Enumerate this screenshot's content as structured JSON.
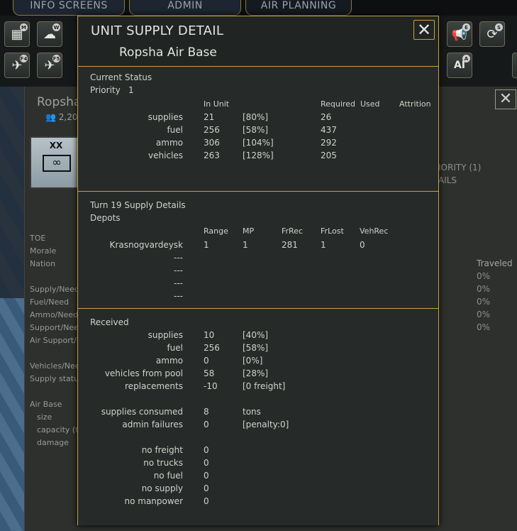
{
  "top_tabs": [
    "INFO SCREENS",
    "ADMIN",
    "AIR PLANNING"
  ],
  "toolbar_tags": [
    "M",
    "W",
    "F4",
    "F5",
    "E",
    "S",
    "A"
  ],
  "toolbar_text": [
    "AI"
  ],
  "unit_panel": {
    "name_partial": "Ropsha",
    "strength_partial": "2,20",
    "counter_label": "XX",
    "right_lines": [
      "IORITY (1)",
      "AILS"
    ],
    "labels": [
      "TOE",
      "Morale",
      "Nation",
      "",
      "Supply/Need",
      "Fuel/Need",
      "Ammo/Need",
      "Support/Nee",
      "Air Support/N",
      "",
      "Vehicles/Nee",
      "Supply status",
      "",
      "Air Base",
      "size",
      "capacity (to",
      "damage"
    ],
    "traveled_header": "Traveled",
    "traveled_values": [
      "0%",
      "0%",
      "0%",
      "0%",
      "0%"
    ]
  },
  "modal": {
    "title": "UNIT SUPPLY DETAIL",
    "subtitle": "Ropsha Air Base",
    "current_status": {
      "heading": "Current Status",
      "priority_label": "Priority",
      "priority_value": "1",
      "columns": [
        "In Unit",
        "Required",
        "Used",
        "Attrition"
      ],
      "rows": [
        {
          "label": "supplies",
          "in_unit": "21",
          "pct": "[80%]",
          "required": "26"
        },
        {
          "label": "fuel",
          "in_unit": "256",
          "pct": "[58%]",
          "required": "437"
        },
        {
          "label": "ammo",
          "in_unit": "306",
          "pct": "[104%]",
          "required": "292"
        },
        {
          "label": "vehicles",
          "in_unit": "263",
          "pct": "[128%]",
          "required": "205"
        }
      ]
    },
    "turn_details": {
      "heading": "Turn 19 Supply Details",
      "subheading": "Depots",
      "columns": [
        "Range",
        "MP",
        "FrRec",
        "FrLost",
        "VehRec"
      ],
      "rows": [
        {
          "name": "Krasnogvardeysk",
          "values": [
            "1",
            "1",
            "281",
            "1",
            "0"
          ]
        },
        {
          "name": "---",
          "values": []
        },
        {
          "name": "---",
          "values": []
        },
        {
          "name": "---",
          "values": []
        },
        {
          "name": "---",
          "values": []
        }
      ]
    },
    "received": {
      "heading": "Received",
      "rows": [
        {
          "label": "supplies",
          "value": "10",
          "extra": "[40%]"
        },
        {
          "label": "fuel",
          "value": "256",
          "extra": "[58%]"
        },
        {
          "label": "ammo",
          "value": "0",
          "extra": "[0%]"
        },
        {
          "label": "vehicles from pool",
          "value": "58",
          "extra": "[28%]"
        },
        {
          "label": "replacements",
          "value": "-10",
          "extra": "[0 freight]"
        },
        {
          "label": "",
          "value": "",
          "extra": ""
        },
        {
          "label": "supplies consumed",
          "value": "8",
          "extra": "tons"
        },
        {
          "label": "admin failures",
          "value": "0",
          "extra": "[penalty:0]"
        },
        {
          "label": "",
          "value": "",
          "extra": ""
        },
        {
          "label": "no freight",
          "value": "0",
          "extra": ""
        },
        {
          "label": "no trucks",
          "value": "0",
          "extra": ""
        },
        {
          "label": "no fuel",
          "value": "0",
          "extra": ""
        },
        {
          "label": "no supply",
          "value": "0",
          "extra": ""
        },
        {
          "label": "no manpower",
          "value": "0",
          "extra": ""
        }
      ]
    }
  },
  "colors": {
    "accent": "#c9a33a",
    "panel": "#262b29",
    "text": "#cfd2cb"
  }
}
